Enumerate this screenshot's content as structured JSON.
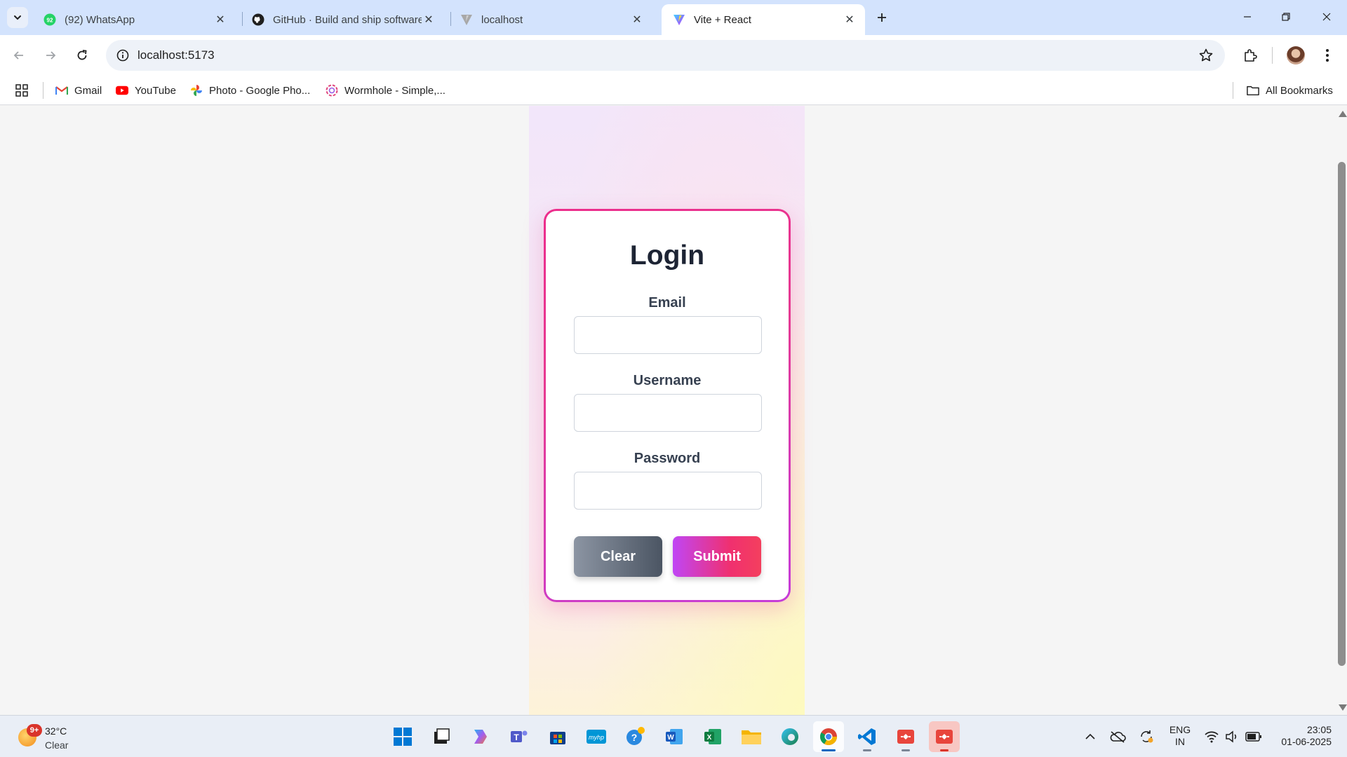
{
  "browser": {
    "tabs": [
      {
        "title": "(92) WhatsApp",
        "badge": "92",
        "icon": "whatsapp-icon"
      },
      {
        "title": "GitHub · Build and ship software",
        "icon": "github-icon"
      },
      {
        "title": "localhost",
        "icon": "vite-icon"
      },
      {
        "title": "Vite + React",
        "icon": "vite-icon",
        "active": true
      }
    ],
    "url": "localhost:5173",
    "bookmarks": [
      {
        "label": "Gmail",
        "icon": "gmail-icon"
      },
      {
        "label": "YouTube",
        "icon": "youtube-icon"
      },
      {
        "label": "Photo - Google Pho...",
        "icon": "google-photos-icon"
      },
      {
        "label": "Wormhole - Simple,...",
        "icon": "wormhole-icon"
      }
    ],
    "all_bookmarks": "All Bookmarks"
  },
  "login": {
    "title": "Login",
    "email_label": "Email",
    "email_value": "",
    "username_label": "Username",
    "username_value": "",
    "password_label": "Password",
    "password_value": "",
    "clear_label": "Clear",
    "submit_label": "Submit"
  },
  "colors": {
    "card_border": "#ec2d8c",
    "submit_gradient": [
      "#c046f5",
      "#f43f5e"
    ],
    "clear_gradient": [
      "#8c95a3",
      "#4b5563"
    ],
    "title": "#1d2434"
  },
  "taskbar": {
    "weather": {
      "badge": "9+",
      "temp": "32°C",
      "condition": "Clear"
    },
    "apps": [
      "windows-start-icon",
      "task-view-icon",
      "copilot-icon",
      "teams-icon",
      "store-icon",
      "myhp-icon",
      "get-help-icon",
      "word-icon",
      "excel-icon",
      "file-explorer-icon",
      "edge-icon",
      "chrome-icon",
      "vscode-icon",
      "git-icon",
      "git-icon"
    ],
    "language": {
      "line1": "ENG",
      "line2": "IN"
    },
    "time": "23:05",
    "date": "01-06-2025"
  }
}
